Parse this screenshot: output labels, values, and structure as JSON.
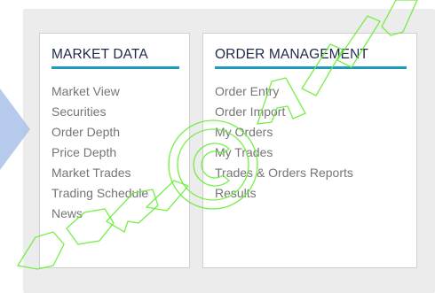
{
  "menus": {
    "market_data": {
      "title": "MARKET DATA",
      "items": [
        "Market View",
        "Securities",
        "Order Depth",
        "Price Depth",
        "Market Trades",
        "Trading Schedule",
        "News"
      ]
    },
    "order_management": {
      "title": "ORDER MANAGEMENT",
      "items": [
        "Order Entry",
        "Order Import",
        "My Orders",
        "My Trades",
        "Trades & Orders Reports",
        "Results"
      ]
    }
  },
  "colors": {
    "accent": "#1d9bbe",
    "title_text": "#1e2a4a",
    "item_text": "#757575",
    "background_panel": "#ececec",
    "arrow": "#a9c2e8",
    "watermark": "#66ee33"
  }
}
